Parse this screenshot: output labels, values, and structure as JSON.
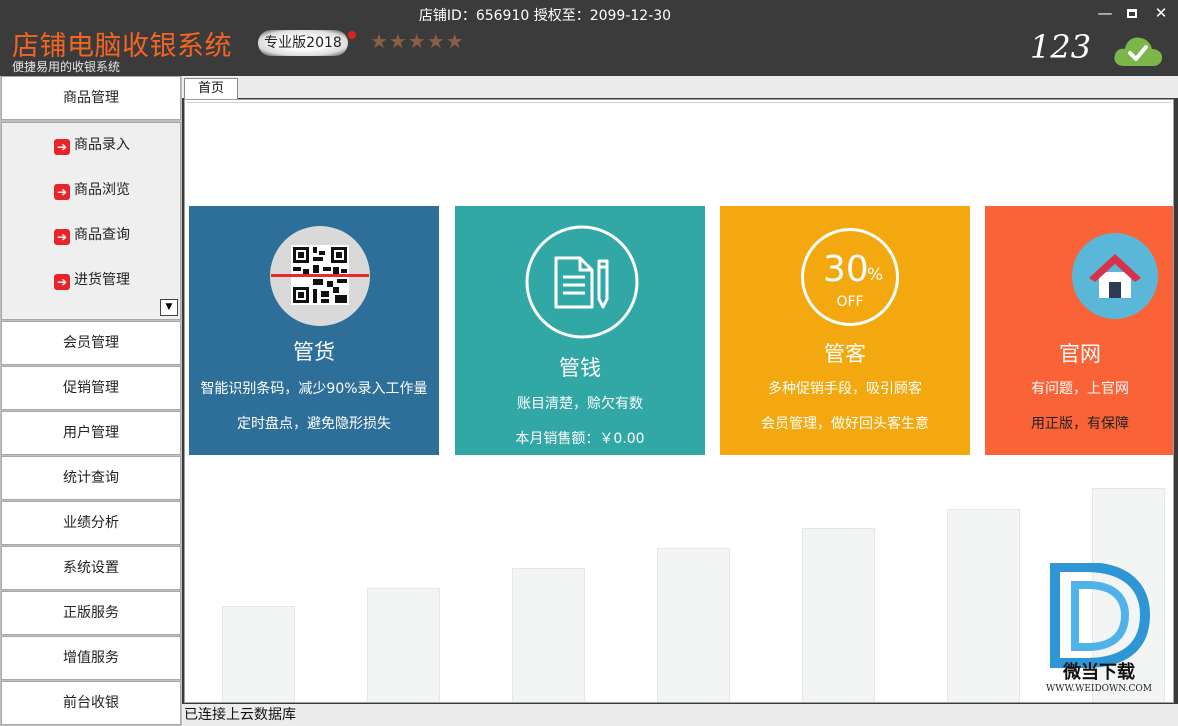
{
  "titlebar": {
    "app_title": "店铺电脑收银系统",
    "app_subtitle": "便捷易用的收银系统",
    "edition": "专业版2018",
    "stars": "★★★★★",
    "shop_info": "店铺ID：656910 授权至：2099-12-30",
    "user_number": "123",
    "window_controls": {
      "minimize": "—",
      "close": "✕"
    }
  },
  "sidebar": {
    "items": [
      {
        "label": "商品管理"
      },
      {
        "label": "会员管理"
      },
      {
        "label": "促销管理"
      },
      {
        "label": "用户管理"
      },
      {
        "label": "统计查询"
      },
      {
        "label": "业绩分析"
      },
      {
        "label": "系统设置"
      },
      {
        "label": "正版服务"
      },
      {
        "label": "增值服务"
      },
      {
        "label": "前台收银"
      }
    ],
    "submenu": [
      {
        "label": "商品录入"
      },
      {
        "label": "商品浏览"
      },
      {
        "label": "商品查询"
      },
      {
        "label": "进货管理"
      }
    ],
    "submenu_arrow": "➔",
    "submenu_dropdown": "▼"
  },
  "tabs": [
    {
      "label": "首页"
    }
  ],
  "cards": {
    "goods": {
      "heading": "管货",
      "lines": [
        "智能识别条码，减少90%录入工作量",
        "定时盘点，避免隐形损失"
      ],
      "color": "#2e6f99"
    },
    "money": {
      "heading": "管钱",
      "lines": [
        "账目清楚，赊欠有数",
        "本月销售额：￥0.00"
      ],
      "color": "#32a8a6"
    },
    "customer": {
      "heading": "管客",
      "badge_percent": "30",
      "badge_sign": "%",
      "badge_off": "OFF",
      "lines": [
        "多种促销手段，吸引顾客",
        "会员管理，做好回头客生意"
      ],
      "color": "#f2a80e"
    },
    "website": {
      "heading": "官网",
      "lines": [
        "有问题，上官网",
        "用正版，有保障"
      ],
      "color": "#fa6238"
    }
  },
  "watermark": {
    "name": "微当下载",
    "url": "WWW.WEIDOWN.COM"
  },
  "status": {
    "text": "已连接上云数据库"
  },
  "icons": {
    "cloud": "cloud-check-icon",
    "qr": "qr-code-icon",
    "document": "document-pen-icon",
    "discount": "discount-badge-icon",
    "home": "home-icon"
  }
}
